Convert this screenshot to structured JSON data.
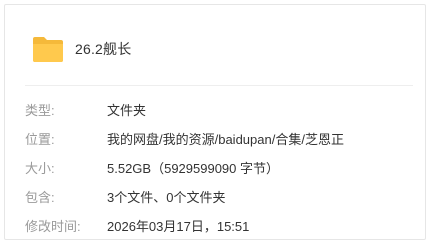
{
  "header": {
    "title": "26.2舰长",
    "icon": "folder-icon",
    "icon_color": "#FFC94D"
  },
  "properties": [
    {
      "label": "类型:",
      "value": "文件夹"
    },
    {
      "label": "位置:",
      "value": "我的网盘/我的资源/baidupan/合集/芝恩正"
    },
    {
      "label": "大小:",
      "value": "5.52GB（5929599090 字节）"
    },
    {
      "label": "包含:",
      "value": "3个文件、0个文件夹"
    },
    {
      "label": "修改时间:",
      "value": "2026年03月17日，15:51"
    }
  ]
}
